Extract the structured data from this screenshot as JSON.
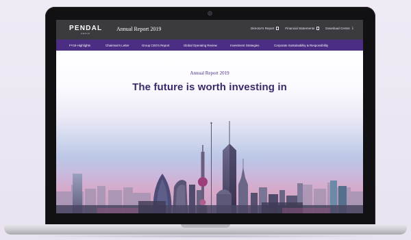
{
  "header": {
    "logo": "PENDAL",
    "logo_sub": "GROUP",
    "report_title": "Annual Report 2019",
    "links": [
      {
        "label": "Director's Report",
        "icon": "document-icon"
      },
      {
        "label": "Financial Statements",
        "icon": "document-icon"
      },
      {
        "label": "Download Centre",
        "icon": "download-icon"
      }
    ]
  },
  "nav": {
    "items": [
      "FY19 Highlights",
      "Chairman's Letter",
      "Group CEO's Report",
      "Global Operating Review",
      "Investment Strategies",
      "Corporate Sustainability & Responsibility"
    ]
  },
  "hero": {
    "eyebrow": "Annual Report 2019",
    "headline": "The future is worth investing in"
  },
  "colors": {
    "nav_purple": "#4b2e83",
    "header_dark": "#3a3a3f",
    "headline": "#3b2a6b"
  }
}
